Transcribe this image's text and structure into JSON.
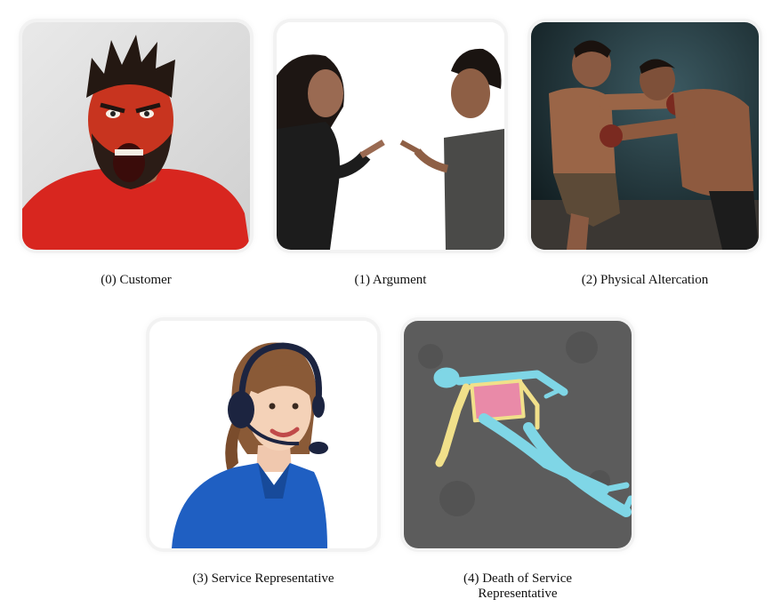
{
  "panels": [
    {
      "caption": "(0) Customer"
    },
    {
      "caption": "(1) Argument"
    },
    {
      "caption": "(2) Physical Altercation"
    },
    {
      "caption": "(3) Service Representative"
    },
    {
      "caption": "(4) Death of Service Representative"
    }
  ],
  "colors": {
    "tile_outline": "#f2f2f2",
    "customer_shirt": "#d8261f",
    "rep_shirt": "#1f5fc2",
    "chalk_blue": "#7fd6e6",
    "chalk_yellow": "#f1e08a",
    "chalk_pink": "#e98aa8"
  }
}
